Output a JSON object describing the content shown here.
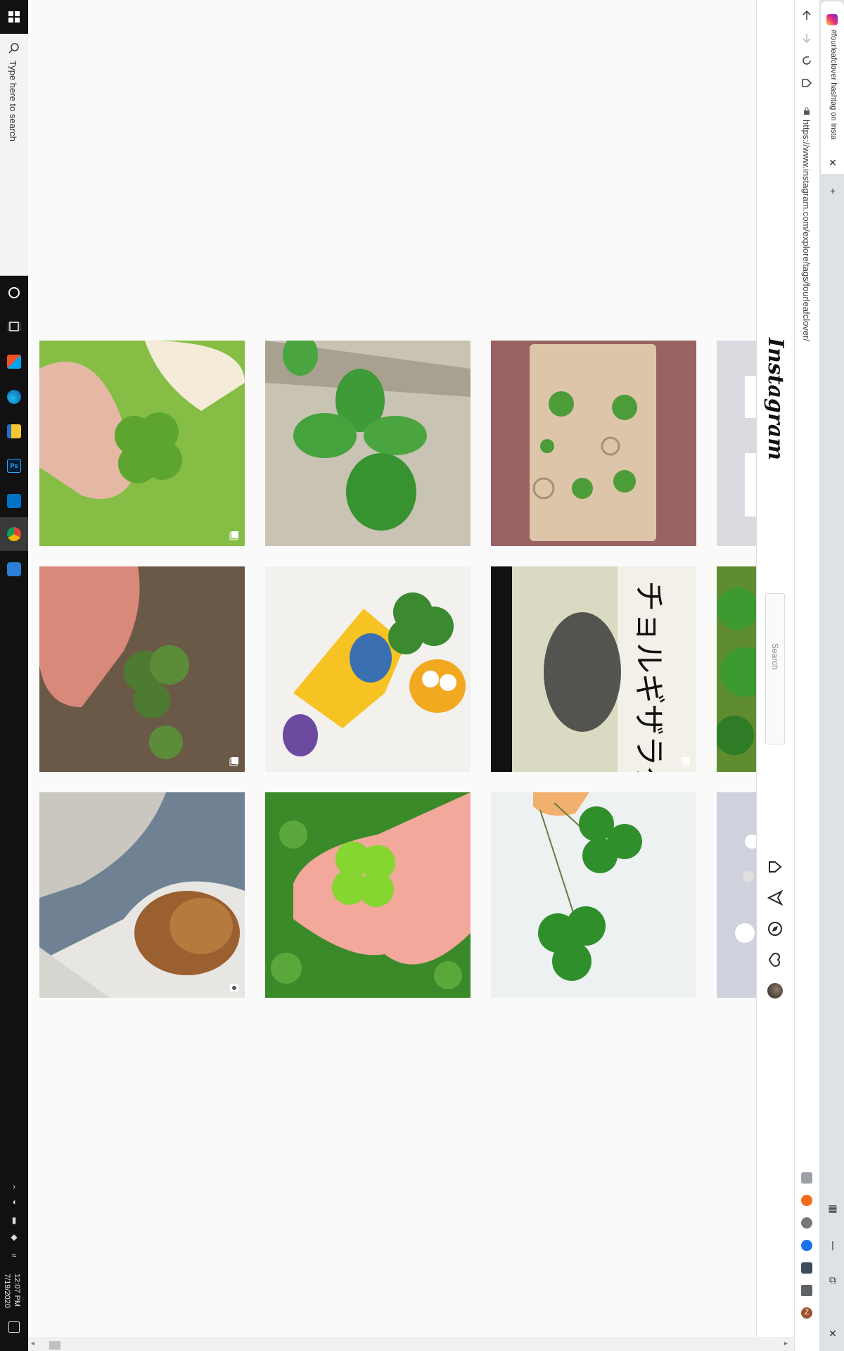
{
  "taskbar": {
    "search_placeholder": "Type here to search",
    "clock_time": "12:07 PM",
    "clock_date": "7/19/2020",
    "apps": [
      "store-icon",
      "edge-icon",
      "file-explorer-icon",
      "photoshop-icon",
      "outlook-icon",
      "chrome-icon",
      "settings-icon"
    ]
  },
  "browser": {
    "tab_title": "#fourleafclover hashtag on Insta",
    "url": "https://www.instagram.com/explore/tags/fourleafclover/",
    "close_tab_glyph": "✕",
    "new_tab_glyph": "+",
    "extensions": [
      "grammarly-icon",
      "ext-orange-icon",
      "ext-circle-icon",
      "ext-blue-icon",
      "ext-image-icon",
      "puzzle-icon",
      "profile-z-icon"
    ]
  },
  "instagram": {
    "logo": "Instagram",
    "search_placeholder": "Search",
    "nav_icons": [
      "home-icon",
      "direct-icon",
      "explore-icon",
      "activity-heart-icon",
      "profile-avatar"
    ],
    "posts": [
      {
        "desc": "hand-holding-clover",
        "type": "carousel"
      },
      {
        "desc": "clover-in-sand",
        "type": "image"
      },
      {
        "desc": "clover-resin-tray",
        "type": "image"
      },
      {
        "desc": "partial",
        "type": "image"
      },
      {
        "desc": "fingers-holding-clover",
        "type": "carousel"
      },
      {
        "desc": "toy-figure-with-clover",
        "type": "image"
      },
      {
        "desc": "japanese-text-clover",
        "type": "carousel"
      },
      {
        "desc": "partial-green",
        "type": "image"
      },
      {
        "desc": "dog-and-person",
        "type": "video"
      },
      {
        "desc": "palm-with-clover",
        "type": "image"
      },
      {
        "desc": "two-clovers-white",
        "type": "image"
      },
      {
        "desc": "partial-grey",
        "type": "image"
      }
    ]
  },
  "colors": {
    "taskbar": "#111111",
    "page_bg": "#fafafa",
    "ig_border": "#dbdbdb",
    "clover_green": "#4caf2a"
  }
}
